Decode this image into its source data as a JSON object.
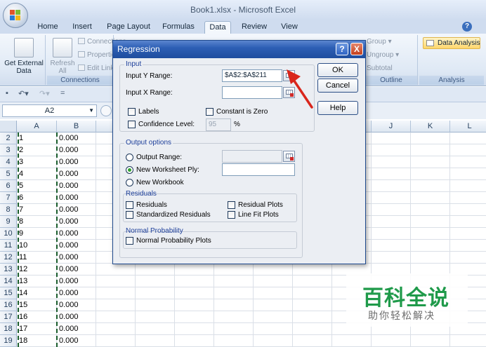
{
  "window": {
    "title": "Book1.xlsx - Microsoft Excel"
  },
  "tabs": [
    "Home",
    "Insert",
    "Page Layout",
    "Formulas",
    "Data",
    "Review",
    "View"
  ],
  "active_tab": "Data",
  "ribbon": {
    "get_external_data": "Get External Data",
    "refresh_all": "Refresh All",
    "connections_items": [
      "Connections",
      "Properties",
      "Edit Links"
    ],
    "connections_group": "Connections",
    "outline_items": [
      "Group",
      "Ungroup",
      "Subtotal"
    ],
    "outline_group": "Outline",
    "data_analysis": "Data Analysis",
    "analysis_group": "Analysis"
  },
  "formula_bar": {
    "name_box": "A2"
  },
  "columns": [
    "A",
    "B",
    "",
    "",
    "",
    "",
    "",
    "",
    "",
    "J",
    "K",
    "L"
  ],
  "rows": [
    {
      "num": "2",
      "a": "1",
      "b": "0.000"
    },
    {
      "num": "3",
      "a": "2",
      "b": "0.000"
    },
    {
      "num": "4",
      "a": "3",
      "b": "0.000"
    },
    {
      "num": "5",
      "a": "4",
      "b": "0.000"
    },
    {
      "num": "6",
      "a": "5",
      "b": "0.000"
    },
    {
      "num": "7",
      "a": "6",
      "b": "0.000"
    },
    {
      "num": "8",
      "a": "7",
      "b": "0.000"
    },
    {
      "num": "9",
      "a": "8",
      "b": "0.000"
    },
    {
      "num": "10",
      "a": "9",
      "b": "0.000"
    },
    {
      "num": "11",
      "a": "10",
      "b": "0.000"
    },
    {
      "num": "12",
      "a": "11",
      "b": "0.000"
    },
    {
      "num": "13",
      "a": "12",
      "b": "0.000"
    },
    {
      "num": "14",
      "a": "13",
      "b": "0.000"
    },
    {
      "num": "15",
      "a": "14",
      "b": "0.000"
    },
    {
      "num": "16",
      "a": "15",
      "b": "0.000"
    },
    {
      "num": "17",
      "a": "16",
      "b": "0.000"
    },
    {
      "num": "18",
      "a": "17",
      "b": "0.000"
    },
    {
      "num": "19",
      "a": "18",
      "b": "0.000"
    }
  ],
  "dialog": {
    "title": "Regression",
    "help_btn": "?",
    "close_btn": "X",
    "input_group": "Input",
    "input_y_label": "Input Y Range:",
    "input_y_value": "$A$2:$A$211",
    "input_x_label": "Input X Range:",
    "input_x_value": "",
    "labels": "Labels",
    "constant_zero": "Constant is Zero",
    "confidence_level": "Confidence Level:",
    "confidence_value": "95",
    "percent": "%",
    "output_group": "Output options",
    "output_range": "Output Range:",
    "new_worksheet": "New Worksheet Ply:",
    "new_workbook": "New Workbook",
    "residuals_group": "Residuals",
    "residuals": "Residuals",
    "residual_plots": "Residual Plots",
    "std_residuals": "Standardized Residuals",
    "line_fit_plots": "Line Fit Plots",
    "normal_prob_group": "Normal Probability",
    "normal_prob_plots": "Normal Probability Plots",
    "ok": "OK",
    "cancel": "Cancel",
    "help": "Help"
  },
  "watermark": {
    "title": "百科全说",
    "subtitle": "助你轻松解决"
  },
  "colors": {
    "accent_green": "#1f9a4a",
    "dialog_title": "#2d5fb5",
    "arrow_red": "#d9261c"
  }
}
